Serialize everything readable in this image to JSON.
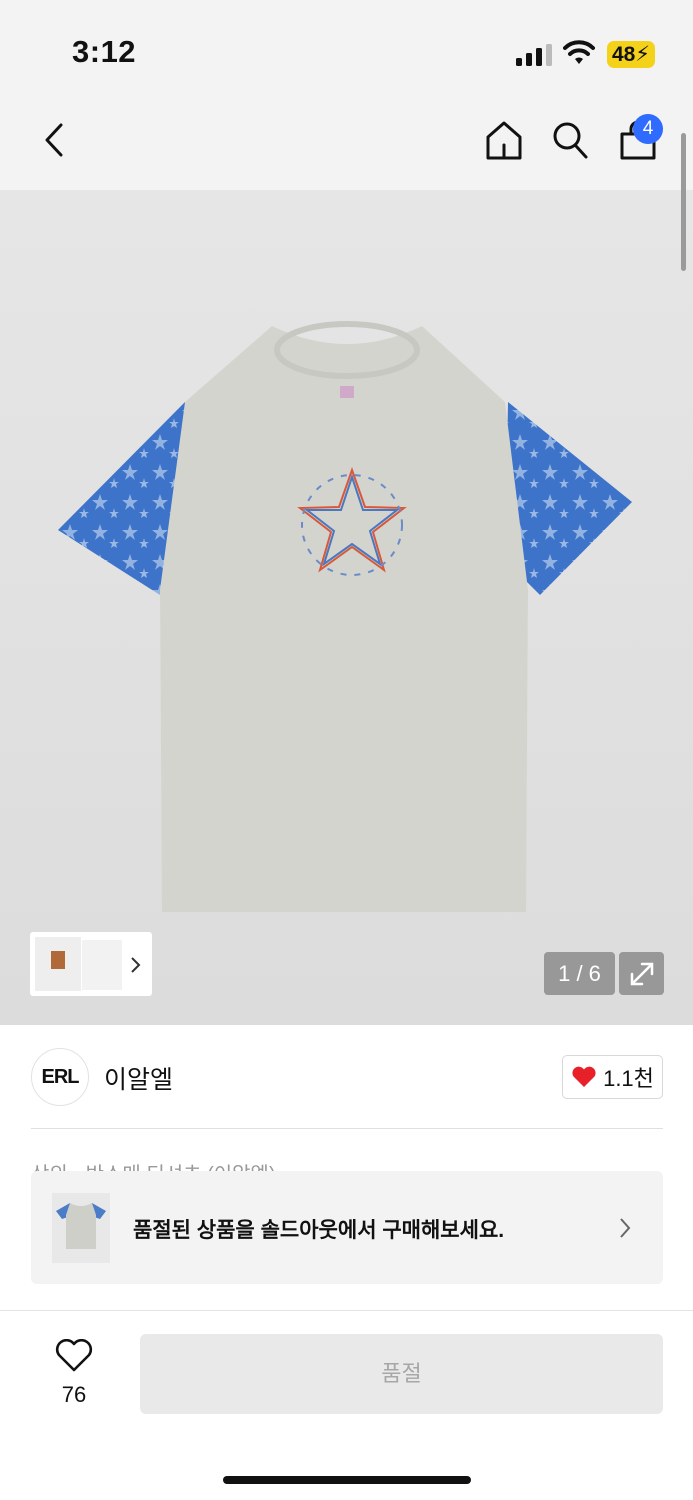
{
  "status_bar": {
    "time": "3:12",
    "battery": "48"
  },
  "top_nav": {
    "cart_count": "4",
    "icons": [
      "back-arrow-icon",
      "home-icon",
      "search-icon",
      "cart-icon"
    ]
  },
  "gallery": {
    "counter": "1 / 6"
  },
  "brand": {
    "logo_text": "ERL",
    "name": "이알엘",
    "likes": "1.1천"
  },
  "breadcrumb": "상의 › 반소매 티셔츠 (이알엘)",
  "banner": {
    "text": "품절된 상품을 솔드아웃에서 구매해보세요."
  },
  "bottom_bar": {
    "wish_count": "76",
    "soldout_label": "품절"
  },
  "colors": {
    "accent_blue": "#2f6bff",
    "heart_red": "#e8202a",
    "battery_yellow": "#f5d21a"
  }
}
